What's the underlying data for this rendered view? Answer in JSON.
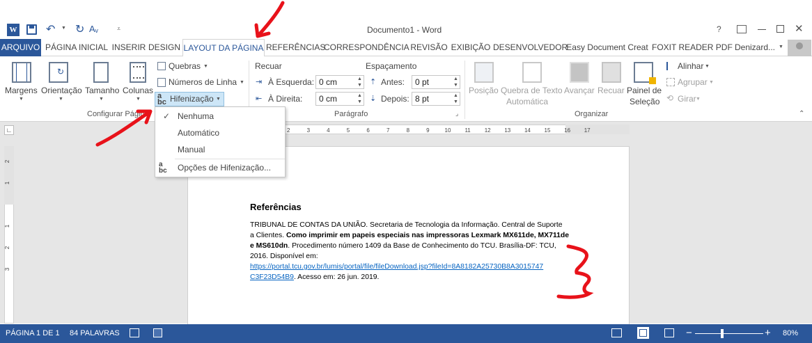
{
  "window": {
    "title": "Documento1 - Word",
    "help": "?"
  },
  "quick_access": {
    "word_icon": "word-icon",
    "save": "save-icon",
    "undo": "undo-icon",
    "redo": "redo-icon",
    "format": "Aᵥ"
  },
  "tabs": [
    {
      "label": "ARQUIVO"
    },
    {
      "label": "PÁGINA INICIAL"
    },
    {
      "label": "INSERIR"
    },
    {
      "label": "DESIGN"
    },
    {
      "label": "LAYOUT DA PÁGINA"
    },
    {
      "label": "REFERÊNCIAS"
    },
    {
      "label": "CORRESPONDÊNCIA"
    },
    {
      "label": "REVISÃO"
    },
    {
      "label": "EXIBIÇÃO"
    },
    {
      "label": "DESENVOLVEDOR"
    },
    {
      "label": "Easy Document Creat"
    },
    {
      "label": "FOXIT READER PDF"
    }
  ],
  "user": "Denizard...",
  "ribbon": {
    "page_setup": {
      "margins": "Margens",
      "orientation": "Orientação",
      "size": "Tamanho",
      "columns": "Colunas",
      "breaks": "Quebras",
      "line_numbers": "Números de Linha",
      "hyphenation": "Hifenização",
      "group_label": "Configurar Página"
    },
    "paragraph": {
      "indent": "Recuar",
      "spacing": "Espaçamento",
      "left_label": "À Esquerda:",
      "left_value": "0 cm",
      "right_label": "À Direita:",
      "right_value": "0 cm",
      "before_label": "Antes:",
      "before_value": "0 pt",
      "after_label": "Depois:",
      "after_value": "8 pt",
      "group_label": "Parágrafo"
    },
    "arrange": {
      "position": "Posição",
      "wrap_line1": "Quebra de Texto",
      "wrap_line2": "Automática",
      "forward": "Avançar",
      "backward": "Recuar",
      "pane_line1": "Painel de",
      "pane_line2": "Seleção",
      "align": "Alinhar",
      "group": "Agrupar",
      "rotate": "Girar",
      "group_label": "Organizar"
    }
  },
  "hyphenation_menu": {
    "none": "Nenhuma",
    "auto": "Automático",
    "manual": "Manual",
    "options": "Opções de Hifenização..."
  },
  "ruler_numbers": [
    "2",
    "1",
    "1",
    "2",
    "3",
    "4",
    "5",
    "6",
    "7",
    "8",
    "9",
    "10",
    "11",
    "12",
    "13",
    "14",
    "15",
    "16",
    "17"
  ],
  "vruler_numbers": [
    "2",
    "1",
    "1",
    "2",
    "3"
  ],
  "document": {
    "heading": "Referências",
    "p1": "TRIBUNAL DE CONTAS DA UNIÃO. Secretaria de Tecnologia da Informação. Central de Suporte",
    "p2a": "a Clientes. ",
    "p2b": "Como imprimir em papeis especiais nas impressoras Lexmark MX611de, MX711de",
    "p3a": "e MS610dn",
    "p3b": ". Procedimento número 1409 da Base de Conhecimento do TCU. Brasília-DF: TCU,",
    "p4": "2016. Disponível em:",
    "link1": "https://portal.tcu.gov.br/lumis/portal/file/fileDownload.jsp?fileId=8A8182A25730B8A3015747",
    "link2": "C3F23D54B9",
    "p5": ". Acesso em: 26 jun. 2019."
  },
  "status": {
    "page": "PÁGINA 1 DE 1",
    "words": "84 PALAVRAS",
    "zoom": "80%"
  },
  "colors": {
    "accent": "#2b579a",
    "annotation": "#e8121a",
    "link": "#0563c1"
  }
}
